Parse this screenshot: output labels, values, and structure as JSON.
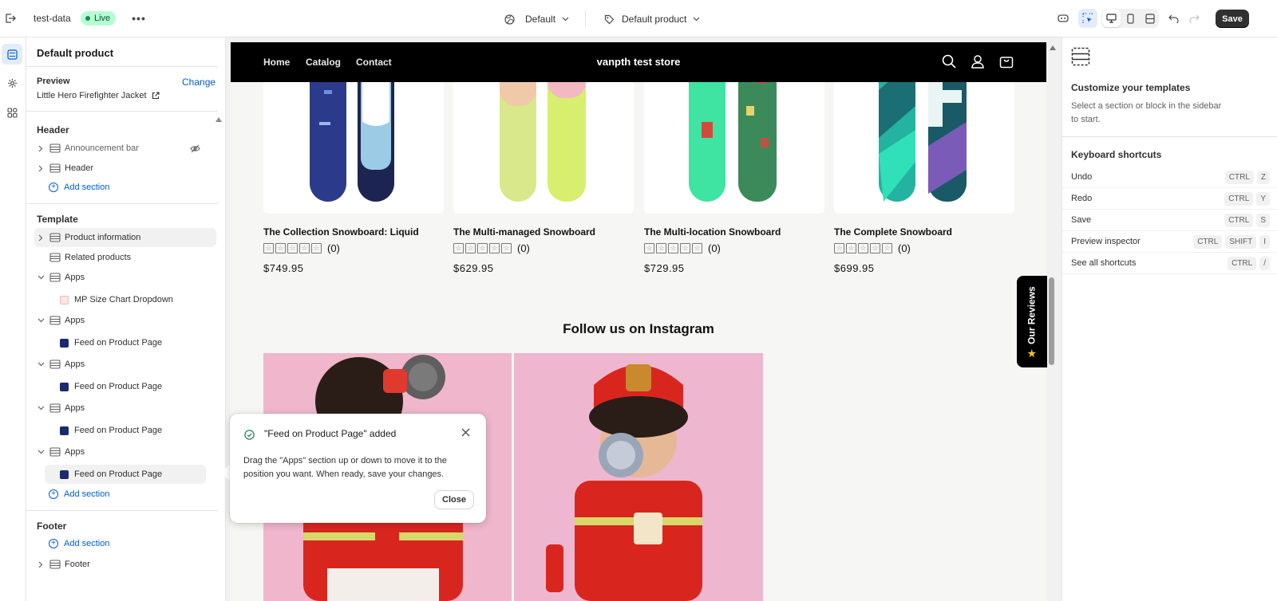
{
  "topbar": {
    "store_name": "test-data",
    "live_badge": "Live",
    "theme_select": "Default",
    "template_select": "Default product",
    "save_label": "Save"
  },
  "sidebar": {
    "title": "Default product",
    "preview_label": "Preview",
    "change_link": "Change",
    "preview_product": "Little Hero Firefighter Jacket",
    "header_group": "Header",
    "header_items": [
      {
        "label": "Announcement bar"
      },
      {
        "label": "Header"
      }
    ],
    "add_section": "Add section",
    "template_group": "Template",
    "template_items": [
      {
        "label": "Product information"
      },
      {
        "label": "Related products"
      },
      {
        "label": "Apps",
        "child": "MP Size Chart Dropdown"
      },
      {
        "label": "Apps",
        "child": "Feed on Product Page"
      },
      {
        "label": "Apps",
        "child": "Feed on Product Page"
      },
      {
        "label": "Apps",
        "child": "Feed on Product Page"
      },
      {
        "label": "Apps",
        "child": "Feed on Product Page"
      }
    ],
    "footer_group": "Footer",
    "footer_item": "Footer"
  },
  "store": {
    "nav": [
      "Home",
      "Catalog",
      "Contact"
    ],
    "store_title": "vanpth test store",
    "products": [
      {
        "name": "The Collection Snowboard: Liquid",
        "reviews": "(0)",
        "price": "$749.95",
        "rating": 0
      },
      {
        "name": "The Multi-managed Snowboard",
        "reviews": "(0)",
        "price": "$629.95",
        "rating": 0
      },
      {
        "name": "The Multi-location Snowboard",
        "reviews": "(0)",
        "price": "$729.95",
        "rating": 0
      },
      {
        "name": "The Complete Snowboard",
        "reviews": "(0)",
        "price": "$699.95",
        "rating": 0
      }
    ],
    "instagram_heading": "Follow us on Instagram",
    "reviews_tab": "Our Reviews"
  },
  "toast": {
    "title": "\"Feed on Product Page\" added",
    "body": "Drag the \"Apps\" section up or down to move it to the position you want. When ready, save your changes.",
    "close_label": "Close"
  },
  "rightpanel": {
    "title": "Customize your templates",
    "description": "Select a section or block in the sidebar to start.",
    "shortcuts_title": "Keyboard shortcuts",
    "shortcuts": [
      {
        "label": "Undo",
        "keys": [
          "CTRL",
          "Z"
        ]
      },
      {
        "label": "Redo",
        "keys": [
          "CTRL",
          "Y"
        ]
      },
      {
        "label": "Save",
        "keys": [
          "CTRL",
          "S"
        ]
      },
      {
        "label": "Preview inspector",
        "keys": [
          "CTRL",
          "SHIFT",
          "I"
        ]
      },
      {
        "label": "See all shortcuts",
        "keys": [
          "CTRL",
          "/"
        ]
      }
    ]
  },
  "colors": {
    "accent": "#005bd3",
    "live": "#b4fed2",
    "save_bg": "#303030"
  }
}
